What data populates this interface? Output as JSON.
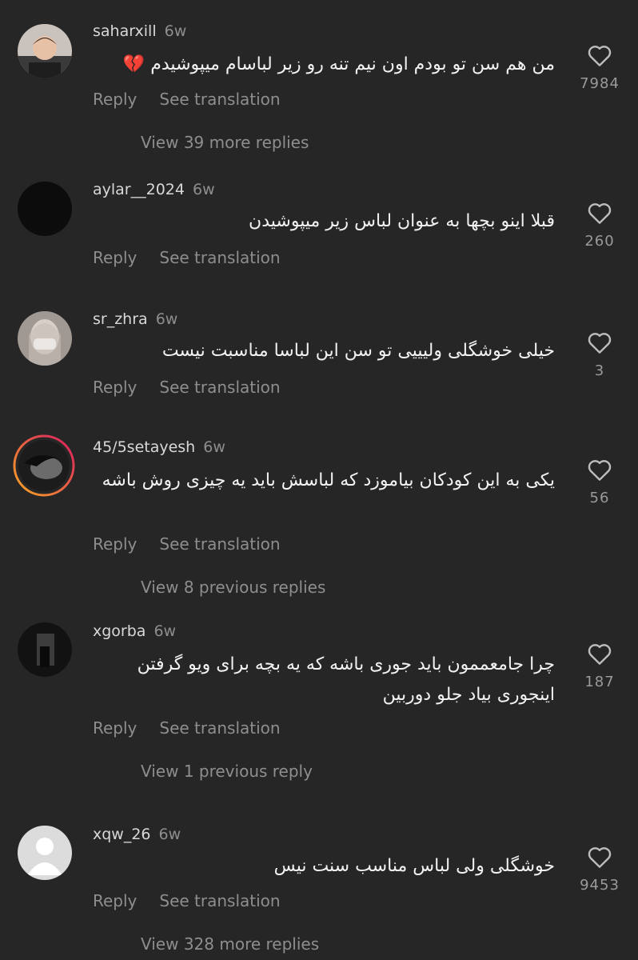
{
  "comments": [
    {
      "username": "saharxill",
      "time": "6w",
      "text": "من هم سن تو بودم اون نیم تنه رو زیر لباسام میپوشیدم 💔",
      "reply_label": "Reply",
      "translate_label": "See translation",
      "likes": "7984",
      "view_replies": "View 39 more replies"
    },
    {
      "username": "aylar__2024",
      "time": "6w",
      "text": "قبلا اینو بچها به عنوان لباس زیر میپوشیدن",
      "reply_label": "Reply",
      "translate_label": "See translation",
      "likes": "260"
    },
    {
      "username": "sr_zhra",
      "time": "6w",
      "text": "خیلی خوشگلی ولیییی تو سن این لباسا مناسبت نیست",
      "reply_label": "Reply",
      "translate_label": "See translation",
      "likes": "3"
    },
    {
      "username": "45/5setayesh",
      "time": "6w",
      "text": "یکی به این کودکان بیاموزد که لباسش باید یه چیزی روش باشه",
      "reply_label": "Reply",
      "translate_label": "See translation",
      "likes": "56",
      "view_replies": "View 8 previous replies"
    },
    {
      "username": "xgorba",
      "time": "6w",
      "text": "چرا جامعممون باید جوری باشه که یه بچه برای ویو گرفتن اینجوری بیاد جلو دوربین",
      "reply_label": "Reply",
      "translate_label": "See translation",
      "likes": "187",
      "view_replies": "View 1 previous reply"
    },
    {
      "username": "xqw_26",
      "time": "6w",
      "text": "خوشگلی ولی لباس مناسب سنت نیس",
      "reply_label": "Reply",
      "translate_label": "See translation",
      "likes": "9453",
      "view_replies": "View 328 more replies"
    }
  ],
  "icons": {
    "like": "heart-outline-icon",
    "default_avatar": "default-avatar-icon"
  },
  "colors": {
    "background": "#262626",
    "muted_text": "#8e8e8e",
    "story_ring_start": "#f9a825",
    "story_ring_end": "#d81b60"
  }
}
